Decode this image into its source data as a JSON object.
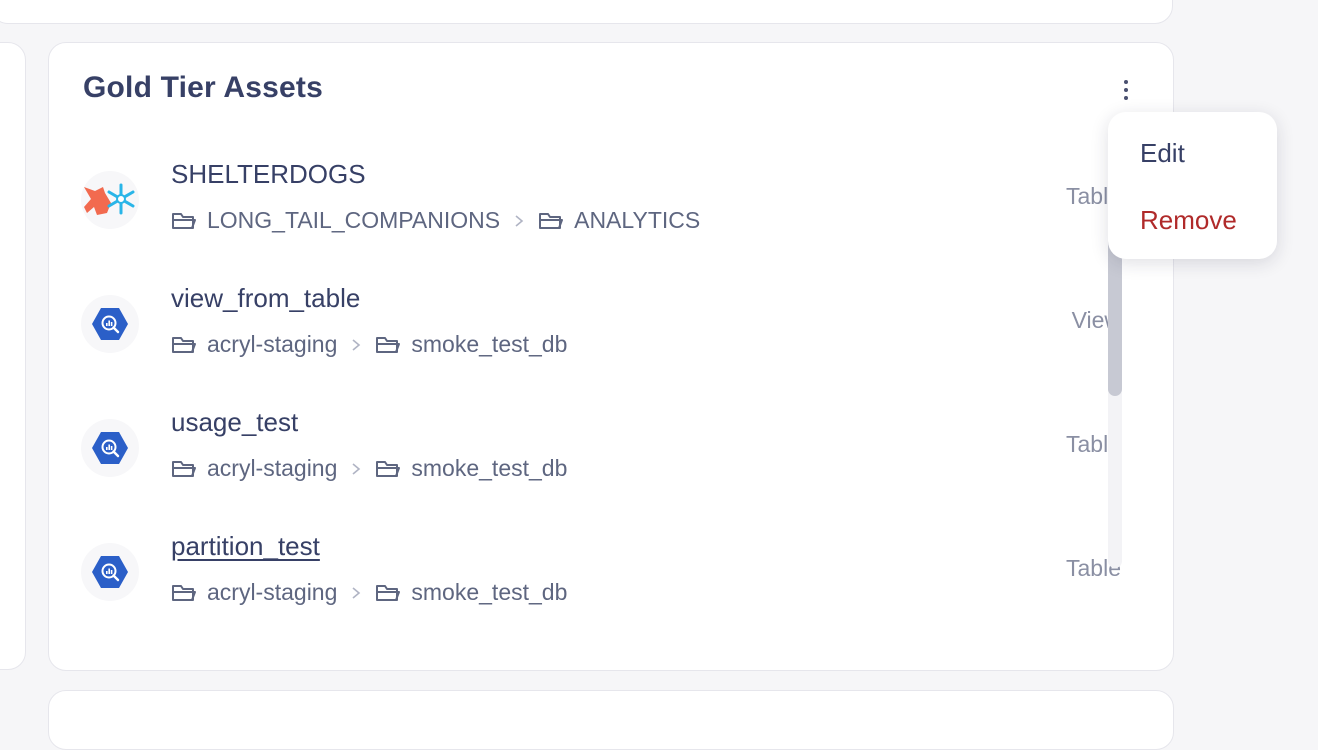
{
  "widget": {
    "title": "Gold Tier Assets"
  },
  "menu": {
    "edit_label": "Edit",
    "remove_label": "Remove"
  },
  "assets": [
    {
      "name": "SHELTERDOGS",
      "platform_icon": "dbt-snowflake-icon",
      "path": [
        "LONG_TAIL_COMPANIONS",
        "ANALYTICS"
      ],
      "type": "Table"
    },
    {
      "name": "view_from_table",
      "platform_icon": "bigquery-icon",
      "path": [
        "acryl-staging",
        "smoke_test_db"
      ],
      "type": "View"
    },
    {
      "name": "usage_test",
      "platform_icon": "bigquery-icon",
      "path": [
        "acryl-staging",
        "smoke_test_db"
      ],
      "type": "Table"
    },
    {
      "name": "partition_test",
      "platform_icon": "bigquery-icon",
      "path": [
        "acryl-staging",
        "smoke_test_db"
      ],
      "type": "Table"
    }
  ],
  "colors": {
    "text_primary": "#374066",
    "text_secondary": "#5e6680",
    "type_label": "#8a8fa3",
    "danger": "#b02a2a",
    "bigquery_blue": "#2b5fc8",
    "snowflake_blue": "#29b5e8",
    "dbt_orange": "#f26a4f"
  }
}
